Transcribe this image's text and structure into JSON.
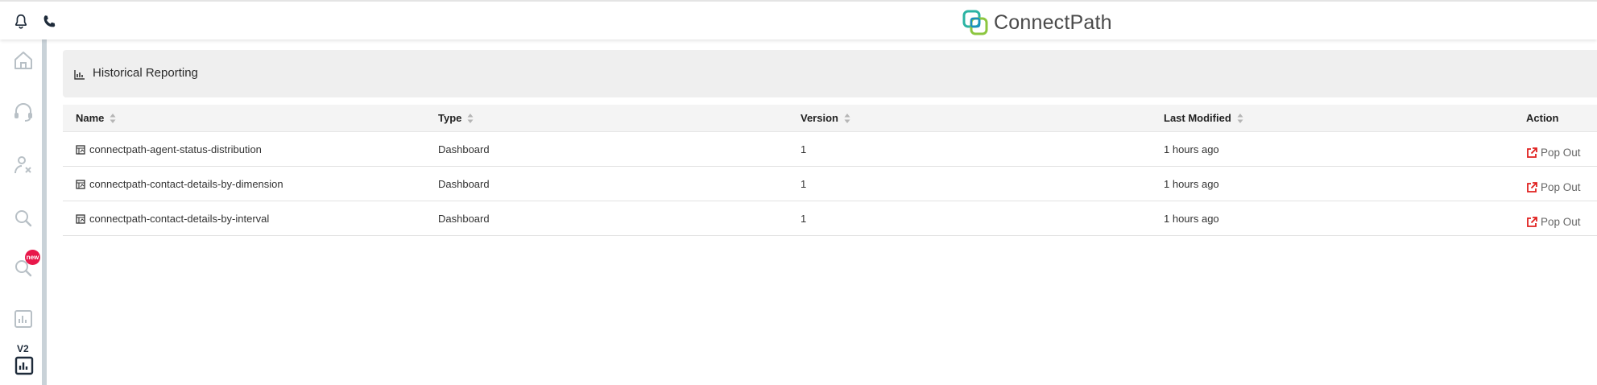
{
  "topbar": {
    "bell_icon": "bell-icon",
    "phone_icon": "phone-icon",
    "brand_name": "ConnectPath"
  },
  "sidebar": {
    "items": [
      {
        "name": "home",
        "icon": "home-icon"
      },
      {
        "name": "headset",
        "icon": "headset-icon"
      },
      {
        "name": "agent",
        "icon": "agent-icon"
      },
      {
        "name": "search",
        "icon": "search-icon"
      },
      {
        "name": "search-new",
        "icon": "search-icon",
        "badge": "new"
      },
      {
        "name": "reporting",
        "icon": "bar-chart-icon"
      },
      {
        "name": "reporting-v2",
        "icon": "bar-chart-icon",
        "label": "V2"
      }
    ],
    "badge_text": "new",
    "v2_label": "V2"
  },
  "page": {
    "title": "Historical Reporting"
  },
  "table": {
    "columns": [
      "Name",
      "Type",
      "Version",
      "Last Modified",
      "Action"
    ],
    "rows": [
      {
        "name": "connectpath-agent-status-distribution",
        "type": "Dashboard",
        "version": "1",
        "last_modified": "1 hours ago",
        "action": "Pop Out"
      },
      {
        "name": "connectpath-contact-details-by-dimension",
        "type": "Dashboard",
        "version": "1",
        "last_modified": "1 hours ago",
        "action": "Pop Out"
      },
      {
        "name": "connectpath-contact-details-by-interval",
        "type": "Dashboard",
        "version": "1",
        "last_modified": "1 hours ago",
        "action": "Pop Out"
      }
    ]
  },
  "colors": {
    "accent_red": "#e8174a",
    "popout_red": "#e0201f",
    "brand_teal": "#2bb3a3",
    "brand_green": "#8cc63f",
    "sidebar_border": "#c9d2d8"
  }
}
